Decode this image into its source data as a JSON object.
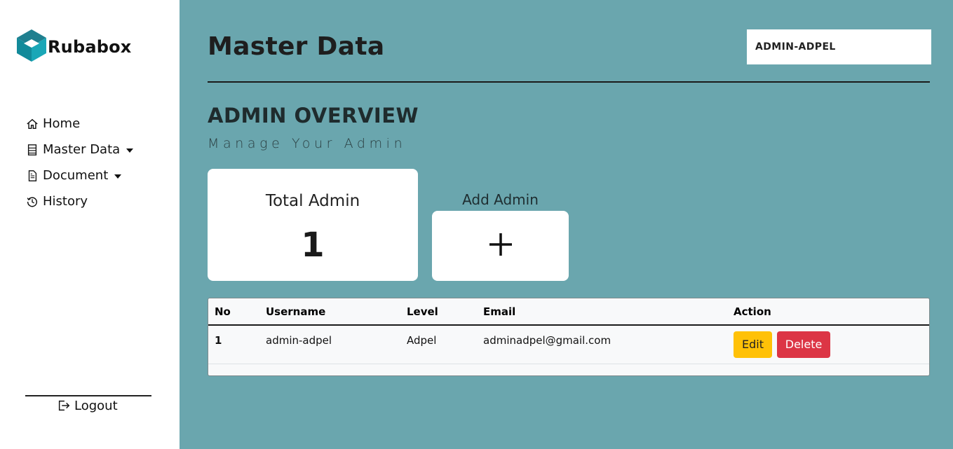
{
  "brand": {
    "name": "Rubabox",
    "logo_icon": "cube-logo-icon",
    "colors": {
      "primary": "#1aa0b0",
      "dark": "#0e7c8c"
    }
  },
  "sidebar": {
    "items": [
      {
        "label": "Home",
        "icon": "home-icon"
      },
      {
        "label": "Master Data",
        "icon": "server-icon",
        "dropdown": true
      },
      {
        "label": "Document",
        "icon": "document-icon",
        "dropdown": true
      },
      {
        "label": "History",
        "icon": "history-icon"
      }
    ],
    "logout": {
      "label": "Logout",
      "icon": "logout-icon"
    }
  },
  "header": {
    "title": "Master Data",
    "user": "ADMIN-ADPEL"
  },
  "section": {
    "title": "ADMIN OVERVIEW",
    "subtitle": "Manage Your Admin"
  },
  "stats": {
    "total_label": "Total Admin",
    "total_value": "1"
  },
  "add": {
    "label": "Add Admin",
    "icon": "plus-icon"
  },
  "table": {
    "columns": [
      "No",
      "Username",
      "Level",
      "Email",
      "Action"
    ],
    "rows": [
      {
        "no": "1",
        "username": "admin-adpel",
        "level": "Adpel",
        "email": "adminadpel@gmail.com",
        "edit": "Edit",
        "delete": "Delete"
      }
    ]
  },
  "colors": {
    "background": "#6aa6ae",
    "edit": "#ffc107",
    "delete": "#dc3545"
  }
}
